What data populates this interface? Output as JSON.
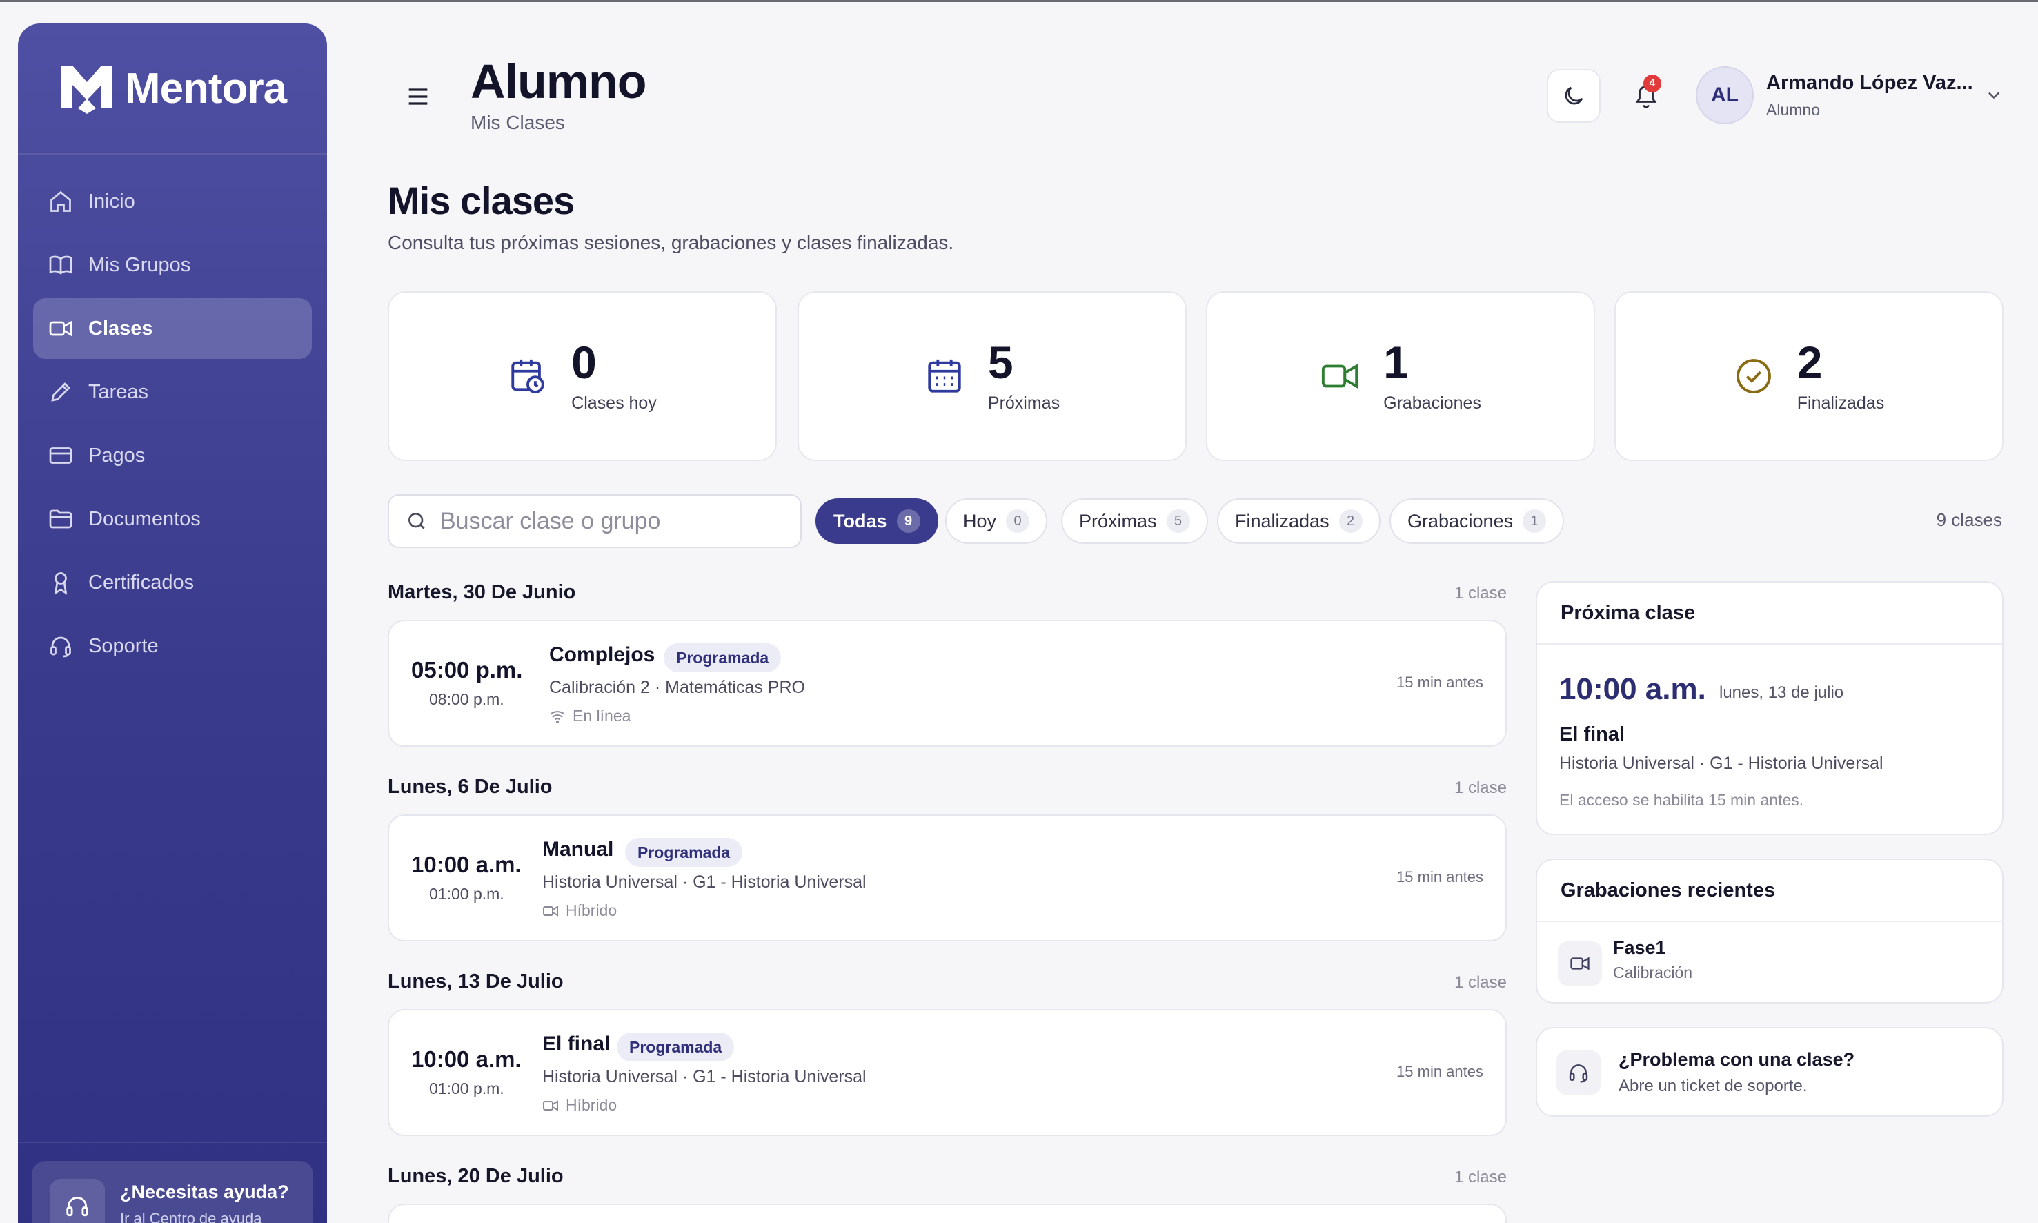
{
  "brand": {
    "name": "Mentora"
  },
  "sidebar": {
    "items": [
      {
        "label": "Inicio",
        "icon": "home-icon"
      },
      {
        "label": "Mis Grupos",
        "icon": "book-icon"
      },
      {
        "label": "Clases",
        "icon": "video-icon",
        "active": true
      },
      {
        "label": "Tareas",
        "icon": "pencil-icon"
      },
      {
        "label": "Pagos",
        "icon": "credit-card-icon"
      },
      {
        "label": "Documentos",
        "icon": "folder-icon"
      },
      {
        "label": "Certificados",
        "icon": "award-icon"
      },
      {
        "label": "Soporte",
        "icon": "headset-icon"
      }
    ],
    "help": {
      "title": "¿Necesitas ayuda?",
      "subtitle": "Ir al Centro de ayuda"
    }
  },
  "header": {
    "title": "Alumno",
    "subtitle": "Mis Clases",
    "notifications": "4",
    "user": {
      "initials": "AL",
      "name": "Armando López Vaz...",
      "role": "Alumno"
    }
  },
  "section": {
    "title": "Mis clases",
    "subtitle": "Consulta tus próximas sesiones, grabaciones y clases finalizadas."
  },
  "stats": [
    {
      "value": "0",
      "label": "Clases hoy",
      "icon": "calendar-clock-icon",
      "color": "#2f3a9e"
    },
    {
      "value": "5",
      "label": "Próximas",
      "icon": "calendar-icon",
      "color": "#2f3a9e"
    },
    {
      "value": "1",
      "label": "Grabaciones",
      "icon": "video-icon",
      "color": "#2e7d32"
    },
    {
      "value": "2",
      "label": "Finalizadas",
      "icon": "check-circle-icon",
      "color": "#8a6a12"
    }
  ],
  "filters": {
    "search_placeholder": "Buscar clase o grupo",
    "chips": [
      {
        "label": "Todas",
        "count": "9",
        "active": true
      },
      {
        "label": "Hoy",
        "count": "0"
      },
      {
        "label": "Próximas",
        "count": "5"
      },
      {
        "label": "Finalizadas",
        "count": "2"
      },
      {
        "label": "Grabaciones",
        "count": "1"
      }
    ],
    "total": "9 clases"
  },
  "days": [
    {
      "date": "Martes, 30 De Junio",
      "count": "1 clase",
      "classes": [
        {
          "start": "05:00 p.m.",
          "end": "08:00 p.m.",
          "name": "Complejos",
          "status": "Programada",
          "meta": "Calibración 2 · Matemáticas PRO",
          "mode": "En línea",
          "mode_icon": "wifi-icon",
          "reminder": "15 min antes"
        }
      ]
    },
    {
      "date": "Lunes, 6 De Julio",
      "count": "1 clase",
      "classes": [
        {
          "start": "10:00 a.m.",
          "end": "01:00 p.m.",
          "name": "Manual",
          "status": "Programada",
          "meta": "Historia Universal · G1 - Historia Universal",
          "mode": "Híbrido",
          "mode_icon": "video-icon",
          "reminder": "15 min antes"
        }
      ]
    },
    {
      "date": "Lunes, 13 De Julio",
      "count": "1 clase",
      "classes": [
        {
          "start": "10:00 a.m.",
          "end": "01:00 p.m.",
          "name": "El final",
          "status": "Programada",
          "meta": "Historia Universal · G1 - Historia Universal",
          "mode": "Híbrido",
          "mode_icon": "video-icon",
          "reminder": "15 min antes"
        }
      ]
    },
    {
      "date": "Lunes, 20 De Julio",
      "count": "1 clase",
      "classes": []
    }
  ],
  "next_class": {
    "title": "Próxima clase",
    "time": "10:00 a.m.",
    "date": "lunes, 13 de julio",
    "name": "El final",
    "group": "Historia Universal · G1 - Historia Universal",
    "note": "El acceso se habilita 15 min antes."
  },
  "recordings": {
    "title": "Grabaciones recientes",
    "items": [
      {
        "name": "Fase1",
        "subtitle": "Calibración"
      }
    ]
  },
  "support": {
    "title": "¿Problema con una clase?",
    "subtitle": "Abre un ticket de soporte."
  }
}
